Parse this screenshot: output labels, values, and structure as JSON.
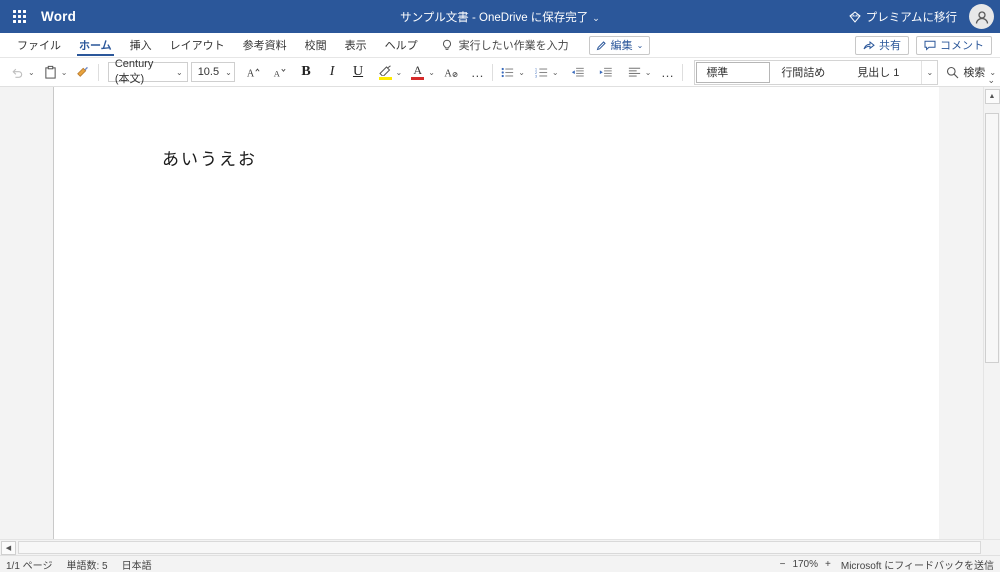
{
  "titlebar": {
    "waffle_label": "app-launcher",
    "app_name": "Word",
    "document_title": "サンプル文書 - OneDrive に保存完了",
    "title_chevron": "⌄",
    "premium_label": "プレミアムに移行",
    "avatar_glyph": "◯",
    "brand_color": "#2b579a"
  },
  "tabs": [
    {
      "label": "ファイル",
      "active": false
    },
    {
      "label": "ホーム",
      "active": true
    },
    {
      "label": "挿入",
      "active": false
    },
    {
      "label": "レイアウト",
      "active": false
    },
    {
      "label": "参考資料",
      "active": false
    },
    {
      "label": "校閲",
      "active": false
    },
    {
      "label": "表示",
      "active": false
    },
    {
      "label": "ヘルプ",
      "active": false
    }
  ],
  "tellme": {
    "placeholder": "実行したい作業を入力"
  },
  "edit_mode": {
    "label": "編集",
    "chevron": "⌄"
  },
  "tabrow_right": {
    "share_label": "共有",
    "comment_label": "コメント"
  },
  "toolbar": {
    "undo_label": "元に戻す",
    "paste_label": "貼り付け",
    "format_painter_label": "書式のコピー/貼り付け",
    "font_name": "Century (本文)",
    "font_size": "10.5",
    "grow_font_label": "フォントサイズの拡大",
    "shrink_font_label": "フォントサイズの縮小",
    "bold_label": "B",
    "italic_label": "I",
    "underline_label": "U",
    "highlight_color": "#ffeb00",
    "font_color": "#d62a2a",
    "clear_format_label": "すべての書式をクリア",
    "more_font_label": "…",
    "bullets_label": "箇条書き",
    "numbering_label": "段落番号",
    "decrease_indent_label": "インデントを減らす",
    "increase_indent_label": "インデントを増やす",
    "align_label": "配置",
    "more_paragraph_label": "…",
    "chevron": "⌄",
    "search_label": "検索",
    "collapse_ribbon": "⌄"
  },
  "styles": [
    {
      "label": "標準",
      "selected": true
    },
    {
      "label": "行間詰め",
      "selected": false
    },
    {
      "label": "見出し 1",
      "selected": false
    }
  ],
  "document": {
    "body_text": "あいうえお"
  },
  "statusbar": {
    "page_info": "1/1 ページ",
    "word_count": "単語数: 5",
    "language": "日本語",
    "zoom_out": "−",
    "zoom_level": "170%",
    "zoom_in": "+",
    "feedback": "Microsoft にフィードバックを送信"
  }
}
